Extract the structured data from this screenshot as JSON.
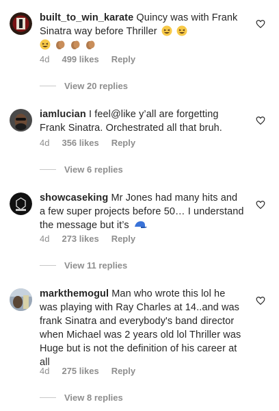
{
  "comments": [
    {
      "username": "built_to_win_karate",
      "text": "Quincy was with Frank Sinatra way before Thriller",
      "time": "4d",
      "likes": "499 likes",
      "reply": "Reply",
      "view_replies": "View 20 replies"
    },
    {
      "username": "iamlucian",
      "text": "I feel@like y’all are forgetting Frank Sinatra. Orchestrated all that bruh.",
      "time": "4d",
      "likes": "356 likes",
      "reply": "Reply",
      "view_replies": "View 6 replies"
    },
    {
      "username": "showcaseking",
      "text": "Mr Jones had many hits and a few  super projects before 50… I understand the message but it’s",
      "time": "4d",
      "likes": "273 likes",
      "reply": "Reply",
      "view_replies": "View 11 replies"
    },
    {
      "username": "markthemogul",
      "text": "Man who wrote this lol he was playing with Ray Charles at 14..and was frank Sinatra and everybody's band director when Michael was 2 years old lol Thriller was Huge but is not the definition of his career at all",
      "time": "4d",
      "likes": "275 likes",
      "reply": "Reply",
      "view_replies": "View 8 replies"
    }
  ],
  "colors": {
    "text": "#262626",
    "meta": "#8e8e8e",
    "divider": "#c7c7c7"
  },
  "icons": [
    "heart-outline-icon",
    "grinning-squinting-emoji",
    "clapping-hands-emoji",
    "blue-cap-emoji"
  ]
}
